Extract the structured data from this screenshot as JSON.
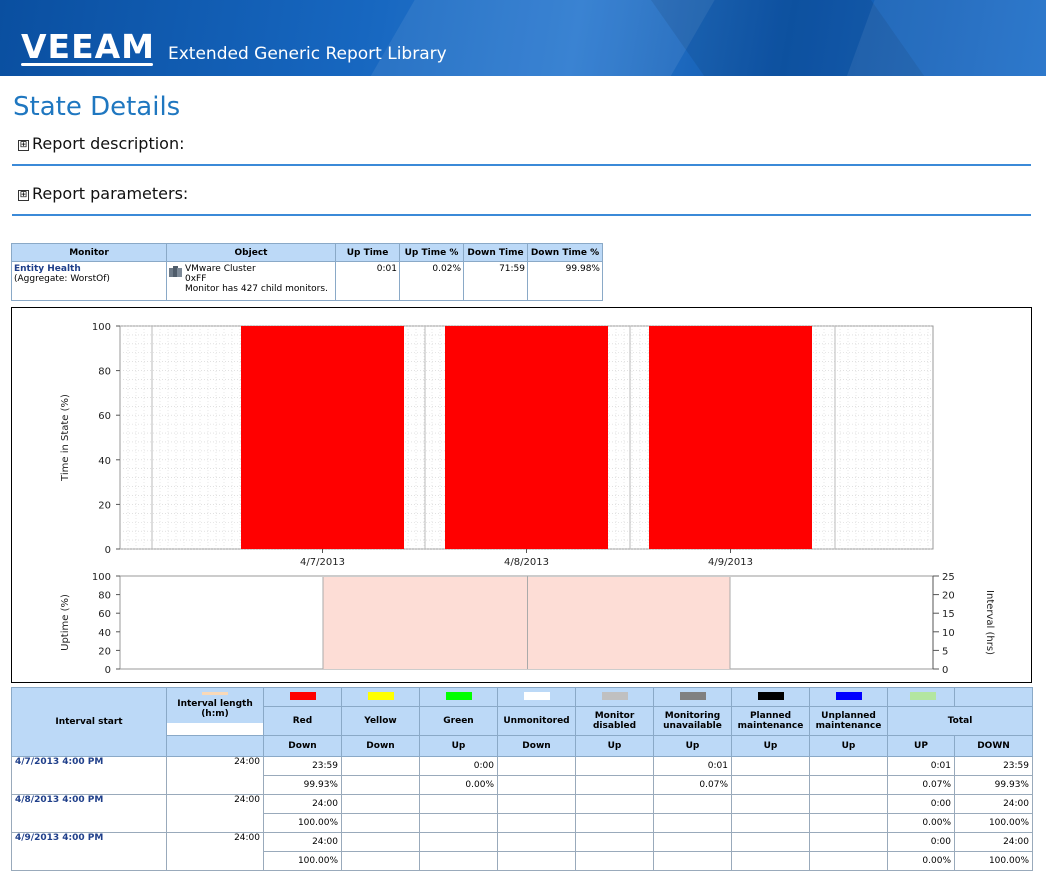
{
  "header": {
    "logo_text": "VEEAM",
    "library_title": "Extended Generic Report Library"
  },
  "page_title": "State Details",
  "sections": {
    "description_label": "Report description:",
    "parameters_label": "Report parameters:",
    "expand_glyph": "⊞"
  },
  "summary_table": {
    "headers": [
      "Monitor",
      "Object",
      "Up Time",
      "Up Time %",
      "Down Time",
      "Down Time %"
    ],
    "row": {
      "monitor_name": "Entity Health",
      "monitor_sub": "(Aggregate: WorstOf)",
      "object_name": "VMware Cluster",
      "object_id": "0xFF",
      "object_note": "Monitor has 427 child monitors.",
      "object_icon": "cluster-icon",
      "up_time": "0:01",
      "up_time_pct": "0.02%",
      "down_time": "71:59",
      "down_time_pct": "99.98%"
    }
  },
  "chart_data": [
    {
      "type": "bar",
      "ylabel": "Time in State (%)",
      "ylim": [
        0,
        100
      ],
      "yticks": [
        "0",
        "20",
        "40",
        "60",
        "80",
        "100"
      ],
      "categories": [
        "4/7/2013",
        "4/8/2013",
        "4/9/2013"
      ],
      "series": [
        {
          "color": "#ff0000",
          "values": [
            100,
            100,
            100
          ]
        }
      ],
      "grid": true
    },
    {
      "type": "area",
      "ylabel": "Uptime (%)",
      "y2label": "Interval (hrs)",
      "ylim": [
        0,
        100
      ],
      "y2lim": [
        0,
        25
      ],
      "yticks": [
        "0",
        "20",
        "40",
        "60",
        "80",
        "100"
      ],
      "y2ticks": [
        "0",
        "5",
        "10",
        "15",
        "20",
        "25"
      ],
      "series": [
        {
          "color": "#fdddd6",
          "values": [
            0,
            100,
            100,
            0
          ]
        }
      ]
    }
  ],
  "detail_table": {
    "col_interval_start": "Interval start",
    "col_interval_length": "Interval length (h:m)",
    "col_total": "Total",
    "states": [
      {
        "name": "Red",
        "sub": "Down",
        "color": "#ff0000"
      },
      {
        "name": "Yellow",
        "sub": "Down",
        "color": "#ffff00"
      },
      {
        "name": "Green",
        "sub": "Up",
        "color": "#00ff00"
      },
      {
        "name": "Unmonitored",
        "sub": "Down",
        "color": "#ffffff"
      },
      {
        "name": "Monitor disabled",
        "sub": "Up",
        "color": "#c0c0c0"
      },
      {
        "name": "Monitoring unavailable",
        "sub": "Up",
        "color": "#808080"
      },
      {
        "name": "Planned maintenance",
        "sub": "Up",
        "color": "#000000"
      },
      {
        "name": "Unplanned maintenance",
        "sub": "Up",
        "color": "#0000ff"
      }
    ],
    "length_swatch_color": "#f9d9b8",
    "total_swatch_color": "#b3e6a0",
    "total_up": "UP",
    "total_down": "DOWN",
    "rows": [
      {
        "start": "4/7/2013 4:00 PM",
        "length": "24:00",
        "red": "23:59",
        "red_pct": "99.93%",
        "green": "0:00",
        "green_pct": "0.00%",
        "unavail": "0:01",
        "unavail_pct": "0.07%",
        "up": "0:01",
        "up_pct": "0.07%",
        "down": "23:59",
        "down_pct": "99.93%"
      },
      {
        "start": "4/8/2013 4:00 PM",
        "length": "24:00",
        "red": "24:00",
        "red_pct": "100.00%",
        "up": "0:00",
        "up_pct": "0.00%",
        "down": "24:00",
        "down_pct": "100.00%"
      },
      {
        "start": "4/9/2013 4:00 PM",
        "length": "24:00",
        "red": "24:00",
        "red_pct": "100.00%",
        "up": "0:00",
        "up_pct": "0.00%",
        "down": "24:00",
        "down_pct": "100.00%"
      }
    ]
  }
}
